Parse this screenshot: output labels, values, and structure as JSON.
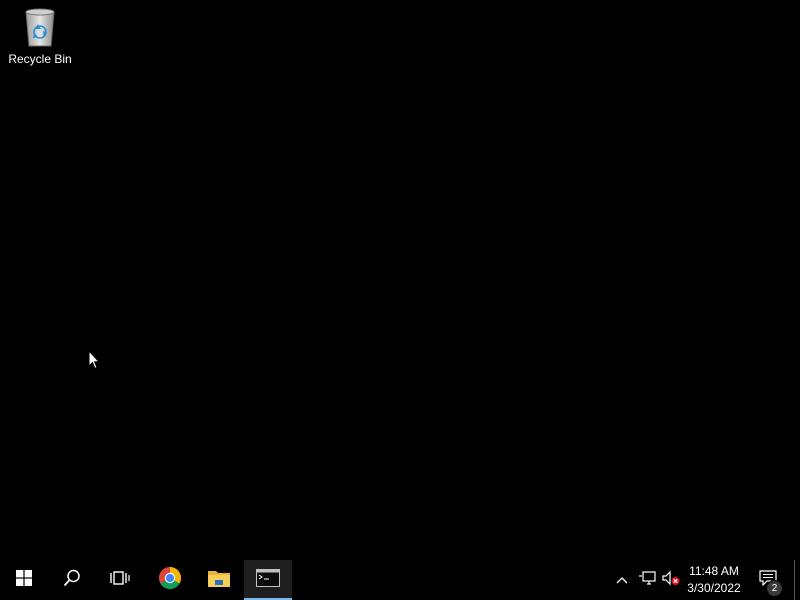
{
  "desktop": {
    "icons": [
      {
        "label": "Recycle Bin",
        "icon": "recycle-bin-icon"
      }
    ]
  },
  "taskbar": {
    "buttons": [
      {
        "name": "start",
        "icon": "windows-logo-icon",
        "active": false
      },
      {
        "name": "search",
        "icon": "search-icon",
        "active": false
      },
      {
        "name": "task-view",
        "icon": "task-view-icon",
        "active": false
      },
      {
        "name": "chrome",
        "icon": "chrome-icon",
        "active": false
      },
      {
        "name": "file-explorer",
        "icon": "folder-icon",
        "active": false
      },
      {
        "name": "command-prompt",
        "icon": "terminal-icon",
        "active": true
      }
    ],
    "tray": {
      "icons": [
        "chevron-up-icon",
        "network-icon",
        "volume-muted-icon"
      ],
      "time": "11:48 AM",
      "date": "3/30/2022",
      "notification_count": "2"
    }
  },
  "colors": {
    "desktop_bg": "#000000",
    "taskbar_bg": "#000000",
    "active_indicator": "#76b9ed"
  }
}
